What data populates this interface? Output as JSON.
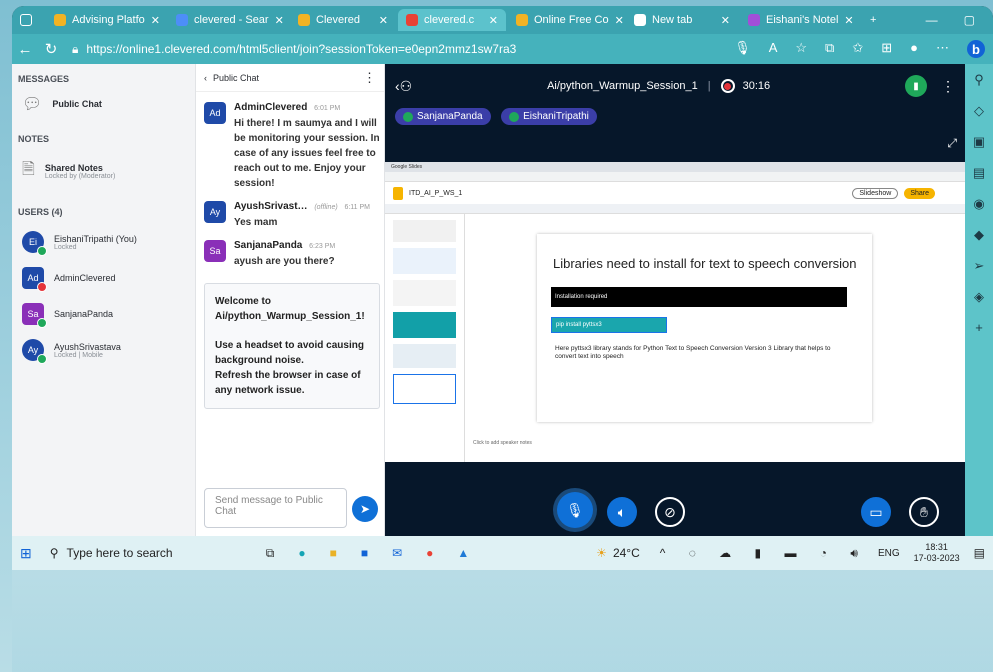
{
  "browser": {
    "tabs": [
      {
        "label": "Advising Platfo",
        "color": "#f2b324"
      },
      {
        "label": "clevered - Sear",
        "color": "#4d8ef7"
      },
      {
        "label": "Clevered",
        "color": "#f2b324"
      },
      {
        "label": "clevered.c",
        "color": "#e94235",
        "active": true
      },
      {
        "label": "Online Free Co",
        "color": "#f2b324"
      },
      {
        "label": "New tab",
        "color": "#ffffff"
      },
      {
        "label": "Eishani's Notel",
        "color": "#a24fd8"
      }
    ],
    "new_tab": "+",
    "url": "https://online1.clevered.com/html5client/join?sessionToken=e0epn2mmz1sw7ra3"
  },
  "left": {
    "messages_heading": "MESSAGES",
    "public_chat": "Public Chat",
    "notes_heading": "NOTES",
    "shared_notes": "Shared Notes",
    "shared_notes_sub": "Locked by (Moderator)",
    "users_heading": "USERS (4)",
    "users": [
      {
        "initials": "Ei",
        "name": "EishaniTripathi (You)",
        "sub": "Locked",
        "color": "#1f4aa8",
        "dot": "#1fa85a"
      },
      {
        "initials": "Ad",
        "name": "AdminClevered",
        "sub": "",
        "color": "#1f4aa8",
        "dot": "#e5343a",
        "square": true
      },
      {
        "initials": "Sa",
        "name": "SanjanaPanda",
        "sub": "",
        "color": "#8a2fb8",
        "dot": "#1fa85a",
        "square": true
      },
      {
        "initials": "Ay",
        "name": "AyushSrivastava",
        "sub": "Locked | Mobile",
        "color": "#1f4aa8",
        "dot": "#1fa85a"
      }
    ]
  },
  "chat": {
    "header": "Public Chat",
    "messages": [
      {
        "initials": "Ad",
        "name": "AdminClevered",
        "time": "6:01 PM",
        "text": "Hi there! I m saumya and I will be monitoring your session. In case of any issues feel free to reach out to me. Enjoy your session!",
        "color": "#1f4aa8"
      },
      {
        "initials": "Ay",
        "name": "AyushSrivast…",
        "status": "(offline)",
        "time": "6:11 PM",
        "text": "Yes mam",
        "color": "#1f4aa8"
      },
      {
        "initials": "Sa",
        "name": "SanjanaPanda",
        "time": "6:23 PM",
        "text": "ayush are you there?",
        "color": "#8a2fb8"
      }
    ],
    "welcome_line1": "Welcome to",
    "welcome_line2": "Ai/python_Warmup_Session_1!",
    "welcome_line3": "Use a headset to avoid causing background noise.",
    "welcome_line4": "Refresh the browser in case of any network issue.",
    "input_placeholder": "Send message to Public Chat"
  },
  "session": {
    "title": "Ai/python_Warmup_Session_1",
    "timer": "30:16",
    "talkers": [
      "SanjanaPanda",
      "EishaniTripathi"
    ]
  },
  "slide": {
    "doc_title": "ITD_AI_P_WS_1",
    "heading": "Libraries need to install for text to speech conversion",
    "band": "Installation required",
    "code": "pip install pyttsx3",
    "body": "Here pyttsx3 library stands for Python Text to Speech Conversion Version 3 Library that helps to convert text into speech",
    "notes_hint": "Click to add speaker notes",
    "slideshow": "Slideshow",
    "share": "Share"
  },
  "taskbar": {
    "search": "Type here to search",
    "weather": "24°C",
    "lang": "ENG",
    "time": "18:31",
    "date": "17-03-2023"
  }
}
